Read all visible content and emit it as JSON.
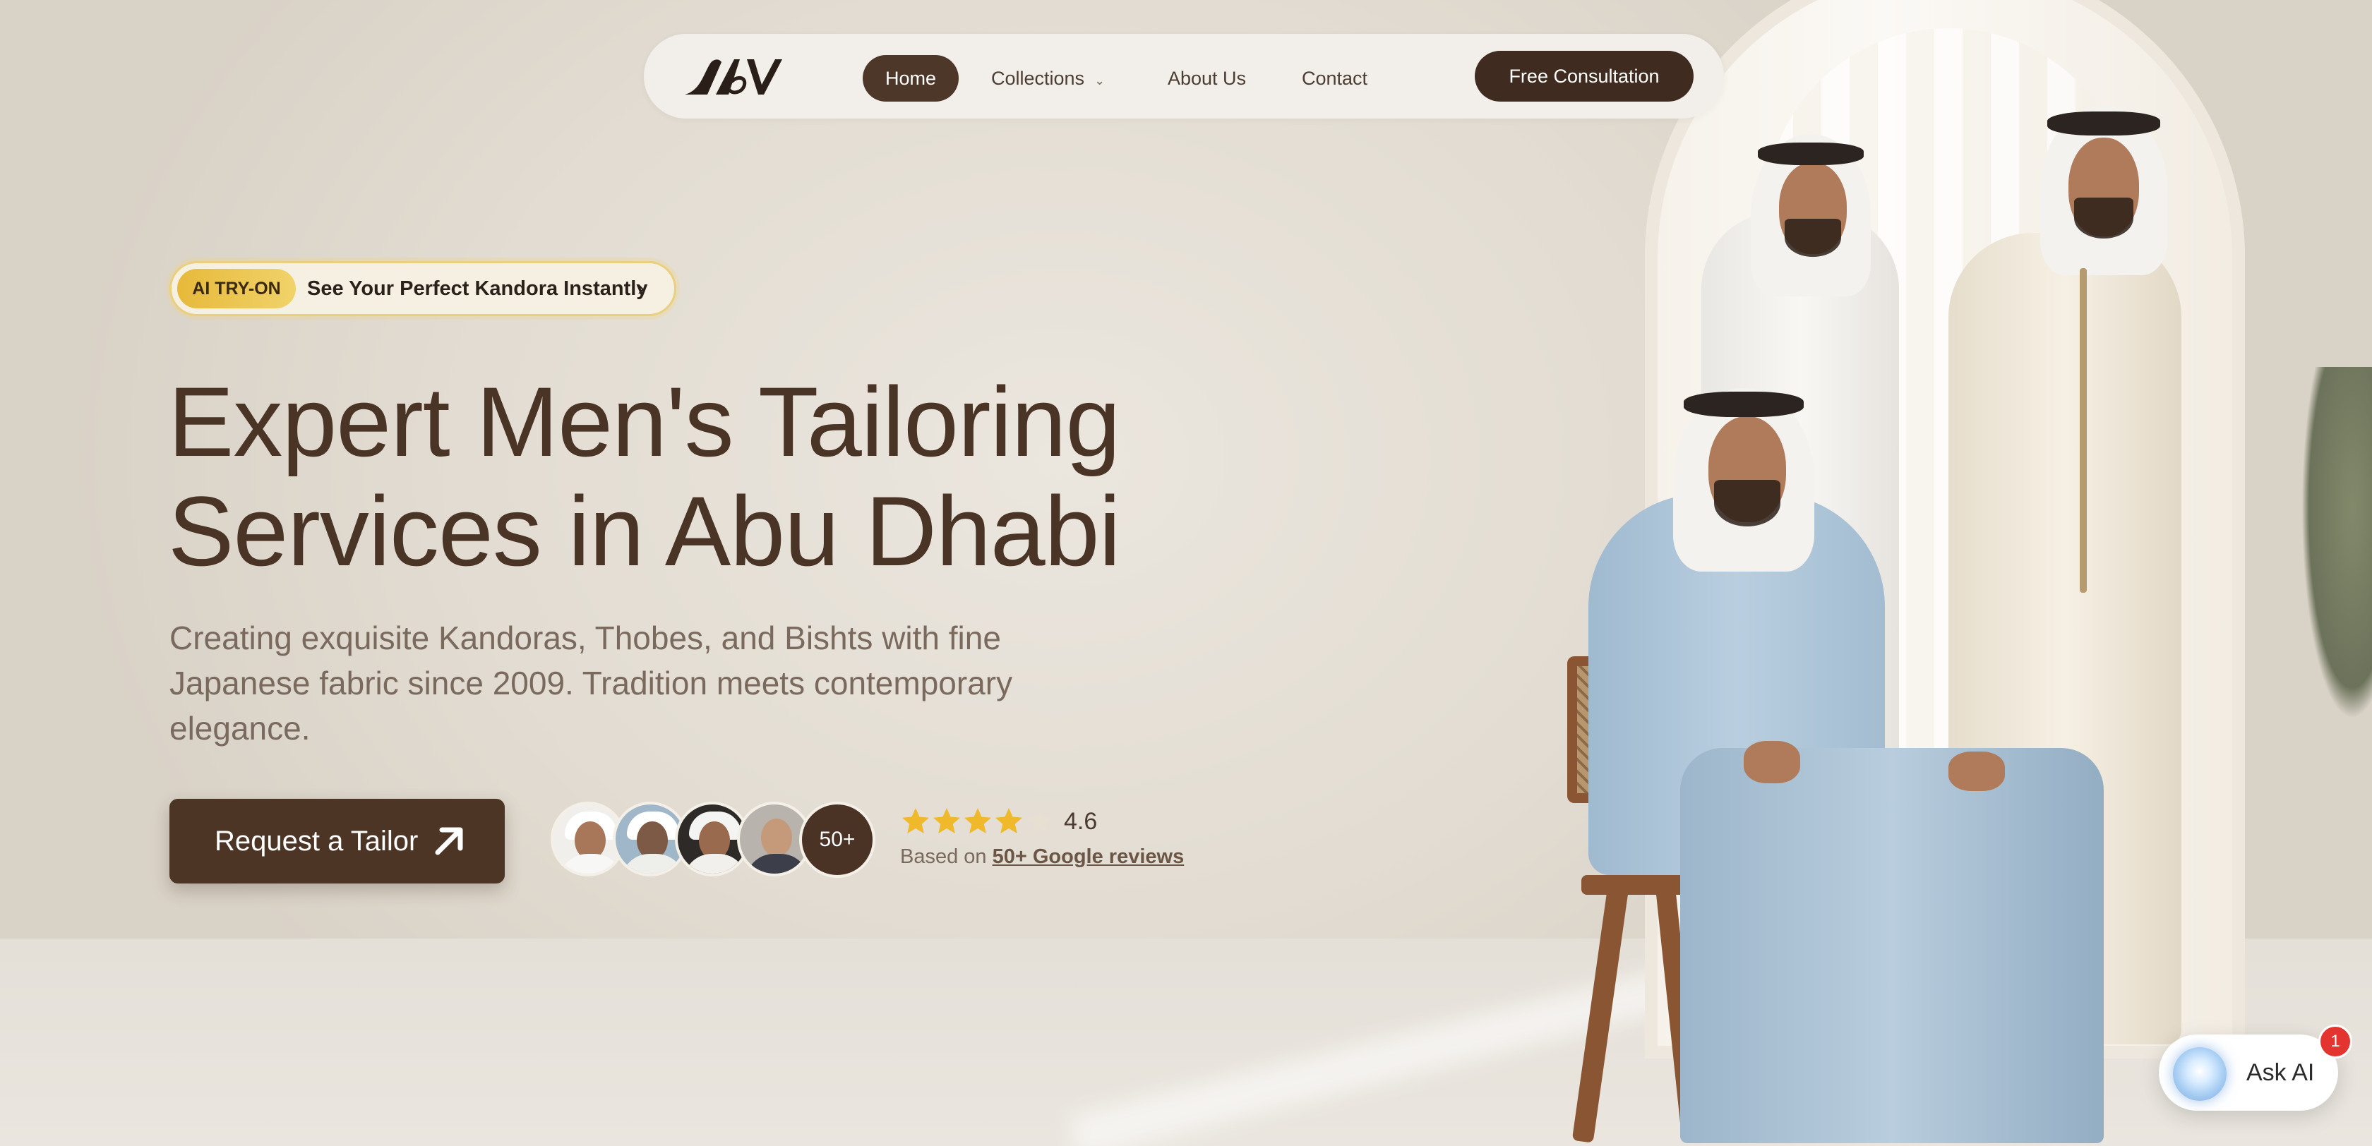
{
  "nav": {
    "logo_text": "SAV",
    "items": [
      {
        "label": "Home",
        "active": true
      },
      {
        "label": "Collections",
        "has_dropdown": true
      },
      {
        "label": "About Us"
      },
      {
        "label": "Contact"
      }
    ],
    "cta_label": "Free Consultation"
  },
  "promo": {
    "badge": "AI TRY-ON",
    "text": "See Your Perfect Kandora Instantly",
    "arrow_icon": "chevron-right-icon"
  },
  "hero": {
    "headline_line1": "Expert Men's Tailoring",
    "headline_line2": "Services in Abu Dhabi",
    "subtitle": "Creating exquisite Kandoras, Thobes, and Bishts with fine Japanese fabric since 2009. Tradition meets contemporary elegance.",
    "cta_label": "Request a Tailor",
    "cta_icon": "arrow-up-right-icon"
  },
  "social_proof": {
    "more_count": "50+",
    "rating_value": 4.6,
    "rating_text": "4.6",
    "based_on": "Based on",
    "reviews_link": "50+ Google reviews"
  },
  "assistant": {
    "label": "Ask AI",
    "notification_count": "1"
  },
  "colors": {
    "brand_dark": "#4d3729",
    "accent_gold": "#e7b93a",
    "star": "#f0b92c",
    "badge_red": "#e3342f"
  }
}
